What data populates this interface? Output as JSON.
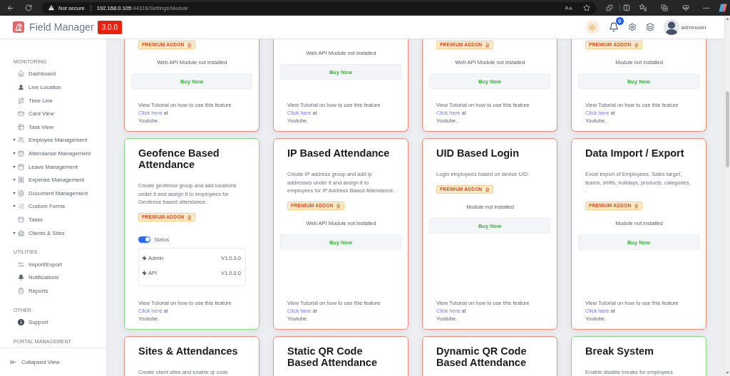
{
  "browser": {
    "security_label": "Not secure",
    "url_host": "192.168.0.105",
    "url_path": ":44316/Settings/Module"
  },
  "header": {
    "app_name": "Field Manager",
    "version": "3.0.0",
    "notification_count": "0",
    "username": "adminuser"
  },
  "sidebar": {
    "sections": [
      {
        "heading": "MONITORING",
        "items": [
          {
            "label": "Dashboard",
            "collapsible": false
          },
          {
            "label": "Live Location",
            "collapsible": false
          },
          {
            "label": "Time Line",
            "collapsible": false
          },
          {
            "label": "Card View",
            "collapsible": false
          },
          {
            "label": "Task View",
            "collapsible": false
          },
          {
            "label": "Employee Management",
            "collapsible": true
          },
          {
            "label": "Attendance Management",
            "collapsible": true
          },
          {
            "label": "Leave Management",
            "collapsible": true
          },
          {
            "label": "Expense Management",
            "collapsible": true
          },
          {
            "label": "Document Management",
            "collapsible": true
          },
          {
            "label": "Custom Forms",
            "collapsible": true
          },
          {
            "label": "Tasks",
            "collapsible": false
          },
          {
            "label": "Clients & Sites",
            "collapsible": true
          }
        ]
      },
      {
        "heading": "UTILITIES",
        "items": [
          {
            "label": "Import/Export",
            "collapsible": false
          },
          {
            "label": "Notifications",
            "collapsible": false
          },
          {
            "label": "Reports",
            "collapsible": false
          }
        ]
      },
      {
        "heading": "OTHER",
        "items": [
          {
            "label": "Support",
            "collapsible": false
          }
        ]
      },
      {
        "heading": "PORTAL MANAGEMENT"
      }
    ],
    "collapse_label": "Collapsed View"
  },
  "modules": [
    {
      "installed": false,
      "badge": "PREMIUM ADDON",
      "install_status": "Web API Module not installed",
      "action": "Buy Now",
      "tutorial": {
        "intro": "View Tutorial on how to use this feature",
        "link": "Click here",
        "link_suffix": "at",
        "outro": "Youtube."
      }
    },
    {
      "installed": false,
      "install_status": "Web API Module not installed",
      "action": "Buy Now",
      "tutorial": {
        "intro": "View Tutorial on how to use this feature",
        "link": "Click here",
        "link_suffix": "at",
        "outro": "Youtube."
      }
    },
    {
      "installed": false,
      "badge": "PREMIUM ADDON",
      "install_status": "Web API Module not installed",
      "action": "Buy Now",
      "tutorial": {
        "intro": "View Tutorial on how to use this feature",
        "link": "Click here",
        "link_suffix": "at",
        "outro": "Youtube."
      }
    },
    {
      "installed": false,
      "badge": "PREMIUM ADDON",
      "install_status": "Module not installed",
      "action": "Buy Now",
      "tutorial": {
        "intro": "View Tutorial on how to use this feature",
        "link": "Click here",
        "link_suffix": "at",
        "outro": "Youtube."
      }
    },
    {
      "title": "Geofence Based Attendance",
      "description": "Create geofence group and add locations under it and assign it to employees for Geofence based attendance.",
      "installed": true,
      "badge": "PREMIUM ADDON",
      "status_toggle": {
        "label": "Status",
        "on": true
      },
      "components": [
        {
          "name": "Admin",
          "version": "V1.0.0.0"
        },
        {
          "name": "API",
          "version": "V1.0.0.0"
        }
      ],
      "tutorial": {
        "intro": "View Tutorial on how to use this feature",
        "link": "Click here",
        "link_suffix": "at",
        "outro": "Youtube."
      }
    },
    {
      "title": "IP Based Attendance",
      "description": "Create IP address group and add ip addresses under it and assign it to employees for IP Address Based Attendance.",
      "installed": false,
      "badge": "PREMIUM ADDON",
      "install_status": "Web API Module not installed",
      "action": "Buy Now",
      "tutorial": {
        "intro": "View Tutorial on how to use this feature",
        "link": "Click here",
        "link_suffix": "at",
        "outro": "Youtube."
      }
    },
    {
      "title": "UID Based Login",
      "description": "Login employees based on device UID.",
      "installed": false,
      "badge": "PREMIUM ADDON",
      "install_status": "Module not installed",
      "action": "Buy Now",
      "tutorial": {
        "intro": "View Tutorial on how to use this feature",
        "link": "Click here",
        "link_suffix": "at",
        "outro": "Youtube."
      }
    },
    {
      "title": "Data Import / Export",
      "description": "Excel import of Employees, Sales target, teams, shifts, holidays, products, categories, .",
      "installed": false,
      "badge": "PREMIUM ADDON",
      "install_status": "Module not installed",
      "action": "Buy Now",
      "tutorial": {
        "intro": "View Tutorial on how to use this feature",
        "link": "Click here",
        "link_suffix": "at",
        "outro": "Youtube."
      }
    },
    {
      "title": "Sites & Attendances",
      "description": "Create client sites and enable qr code",
      "installed": false
    },
    {
      "title": "Static QR Code Based Attendance",
      "installed": false
    },
    {
      "title": "Dynamic QR Code Based Attendance",
      "installed": false
    },
    {
      "title": "Break System",
      "description": "Enable disable breaks for employees",
      "installed": true
    }
  ]
}
